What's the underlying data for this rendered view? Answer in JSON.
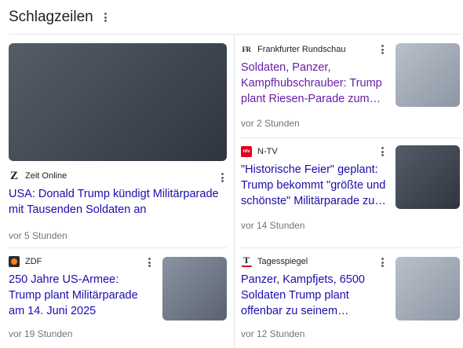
{
  "header": {
    "title": "Schlagzeilen"
  },
  "articles": [
    {
      "source": "Zeit Online",
      "logo_text": "Z",
      "headline": "USA: Donald Trump kündigt Militärparade mit Tausenden Soldaten an",
      "time": "vor 5 Stunden"
    },
    {
      "source": "Frankfurter Rundschau",
      "logo_text": "FR",
      "headline": "Soldaten, Panzer, Kampfhubschrauber: Trump plant Riesen-Parade zum…",
      "time": "vor 2 Stunden"
    },
    {
      "source": "N-TV",
      "logo_text": "ntv",
      "headline": "\"Historische Feier\" geplant: Trump bekommt \"größte und schönste\" Militärparade zu…",
      "time": "vor 14 Stunden"
    },
    {
      "source": "ZDF",
      "logo_text": "",
      "headline": "250 Jahre US-Armee: Trump plant Militärparade am 14. Juni 2025",
      "time": "vor 19 Stunden"
    },
    {
      "source": "Tagesspiegel",
      "logo_text": "T",
      "headline": "Panzer, Kampfjets, 6500 Soldaten Trump plant offenbar zu seinem…",
      "time": "vor 12 Stunden"
    }
  ],
  "colors": {
    "link": "#1a0dab",
    "visited": "#681da8",
    "meta": "#70757a",
    "ntv": "#e2001a",
    "zdf": "#fa7d19",
    "tagesspiegel": "#c8102e"
  }
}
